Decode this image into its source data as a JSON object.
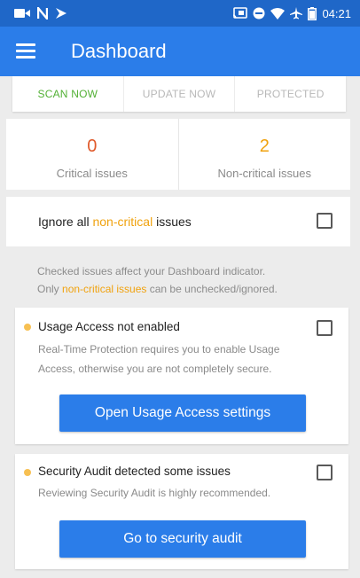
{
  "status_bar": {
    "time": "04:21",
    "icons": [
      "video-icon",
      "n-letter-icon",
      "notification-icon",
      "cast-icon",
      "do-not-disturb-icon",
      "wifi-icon",
      "airplane-icon",
      "battery-icon"
    ]
  },
  "app_bar": {
    "title": "Dashboard",
    "menu_icon": "hamburger-menu-icon"
  },
  "tabs": [
    {
      "label": "SCAN NOW"
    },
    {
      "label": "UPDATE NOW"
    },
    {
      "label": "PROTECTED"
    }
  ],
  "issues": {
    "critical": {
      "count": "0",
      "label": "Critical issues",
      "color": "#e05a2b"
    },
    "non_critical": {
      "count": "2",
      "label": "Non-critical issues",
      "color": "#f0a20e"
    }
  },
  "ignore_row": {
    "prefix": "Ignore all ",
    "highlight": "non-critical",
    "suffix": " issues"
  },
  "note": {
    "line1": "Checked issues affect your Dashboard indicator.",
    "line2_prefix": "Only ",
    "line2_highlight": "non-critical issues",
    "line2_suffix": " can be unchecked/ignored."
  },
  "cards": [
    {
      "title": "Usage Access not enabled",
      "description": "Real-Time Protection requires you to enable Usage Access, otherwise you are not completely secure.",
      "button": "Open Usage Access settings"
    },
    {
      "title": "Security Audit detected some issues",
      "description": "Reviewing Security Audit is highly recommended.",
      "button": "Go to security audit"
    }
  ],
  "colors": {
    "status_bar": "#1f67c8",
    "app_bar": "#2b7de9",
    "accent_green": "#52b035",
    "accent_orange": "#f0a20e"
  }
}
